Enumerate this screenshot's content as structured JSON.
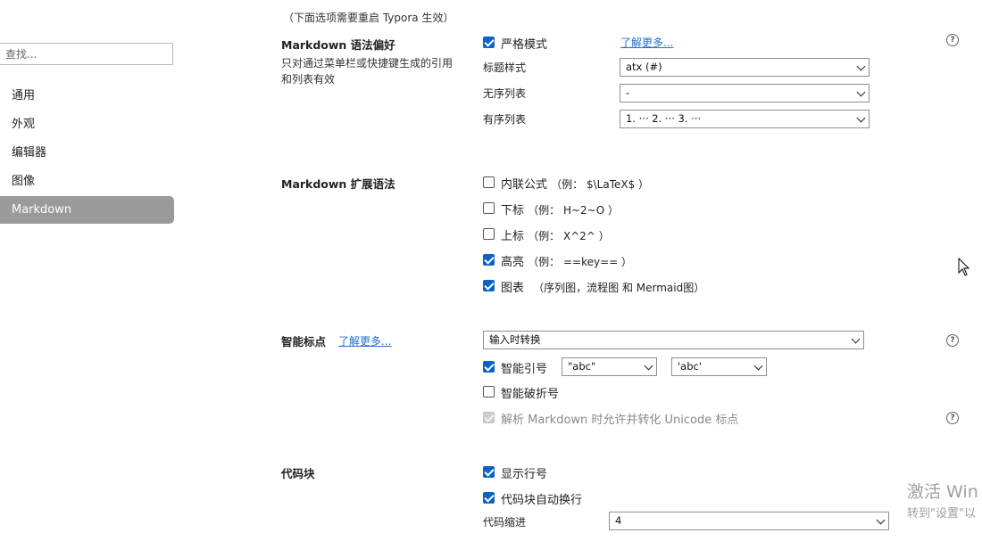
{
  "sidebar": {
    "search_placeholder": "查找...",
    "items": [
      "通用",
      "外观",
      "编辑器",
      "图像",
      "Markdown"
    ],
    "active": "Markdown"
  },
  "notice": "（下面选项需要重启 Typora 生效）",
  "syntax_pref": {
    "heading": "Markdown 语法偏好",
    "description_line1": "只对通过菜单栏或快捷键生成的引用",
    "description_line2": "和列表有效",
    "strict_mode": {
      "label": "严格模式",
      "checked": true
    },
    "learn_more": "了解更多...",
    "heading_style": {
      "label": "标题样式",
      "value": "atx (#)"
    },
    "unordered_list": {
      "label": "无序列表",
      "value": "-"
    },
    "ordered_list": {
      "label": "有序列表",
      "value": "1. ··· 2. ··· 3. ···"
    }
  },
  "extended_syntax": {
    "heading": "Markdown 扩展语法",
    "options": [
      {
        "label": "内联公式",
        "example": "（例： $\\LaTeX$ ）",
        "checked": false
      },
      {
        "label": "下标",
        "example": "（例： H~2~O ）",
        "checked": false
      },
      {
        "label": "上标",
        "example": "（例： X^2^ ）",
        "checked": false
      },
      {
        "label": "高亮",
        "example": "（例： ==key== ）",
        "checked": true
      },
      {
        "label": "图表",
        "example": "（序列图，流程图 和 Mermaid图）",
        "checked": true
      }
    ]
  },
  "smart_punct": {
    "heading": "智能标点",
    "learn_more": "了解更多...",
    "mode_value": "输入时转换",
    "smart_quotes": {
      "label": "智能引号",
      "checked": true,
      "double_value": "\"abc\"",
      "single_value": "'abc'"
    },
    "smart_dash": {
      "label": "智能破折号",
      "checked": false
    },
    "unicode_punct": {
      "label": "解析 Markdown 时允许并转化 Unicode 标点",
      "checked": true,
      "disabled": true
    }
  },
  "code_block": {
    "heading": "代码块",
    "line_numbers": {
      "label": "显示行号",
      "checked": true
    },
    "auto_wrap": {
      "label": "代码块自动换行",
      "checked": true
    },
    "indent": {
      "label": "代码缩进",
      "value": "4"
    }
  },
  "help_icon_glyph": "?",
  "watermark": {
    "line1": "激活 Win",
    "line2": "转到\"设置\"以"
  },
  "colors": {
    "accent": "#0b63c5",
    "link": "#2a6fc9",
    "active_nav": "#9a9a9a"
  }
}
